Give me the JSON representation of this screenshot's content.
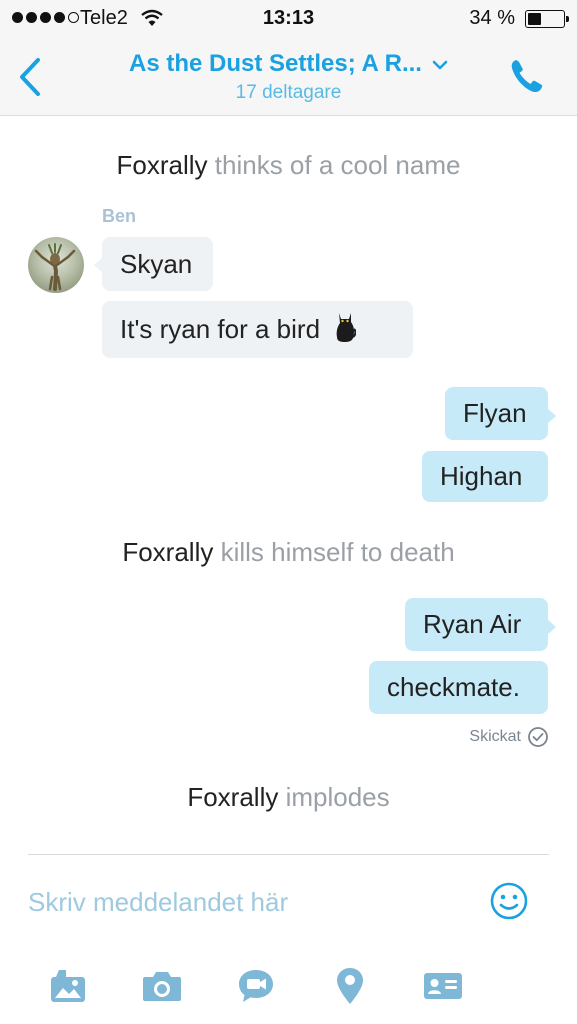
{
  "status_bar": {
    "carrier": "Tele2",
    "time": "13:13",
    "battery_percent": "34 %",
    "battery_level": 0.34,
    "signal_bars_filled": 4,
    "signal_bars_total": 5
  },
  "header": {
    "title": "As the Dust Settles; A R...",
    "subtitle": "17 deltagare",
    "accent_color": "#1aa1e1"
  },
  "messages": {
    "system_1": {
      "who": "Foxrally",
      "action": " thinks of a cool name"
    },
    "sender_ben": "Ben",
    "skyan": "Skyan",
    "ryan_bird": "It's ryan for a bird",
    "flyan": "Flyan",
    "highan": "Highan",
    "system_2": {
      "who": "Foxrally",
      "action": " kills himself to death"
    },
    "ryan_air": "Ryan Air",
    "checkmate": "checkmate.",
    "sent_status": "Skickat",
    "system_3": {
      "who": "Foxrally",
      "action": " implodes"
    }
  },
  "composer": {
    "placeholder": "Skriv meddelandet här"
  },
  "icons": {
    "toolbar": [
      "media-icon",
      "camera-icon",
      "video-message-icon",
      "location-icon",
      "contact-card-icon"
    ]
  },
  "colors": {
    "incoming_bubble": "#eff2f5",
    "outgoing_bubble": "#c7eaf8",
    "icon_tint": "#7fb8d6"
  }
}
